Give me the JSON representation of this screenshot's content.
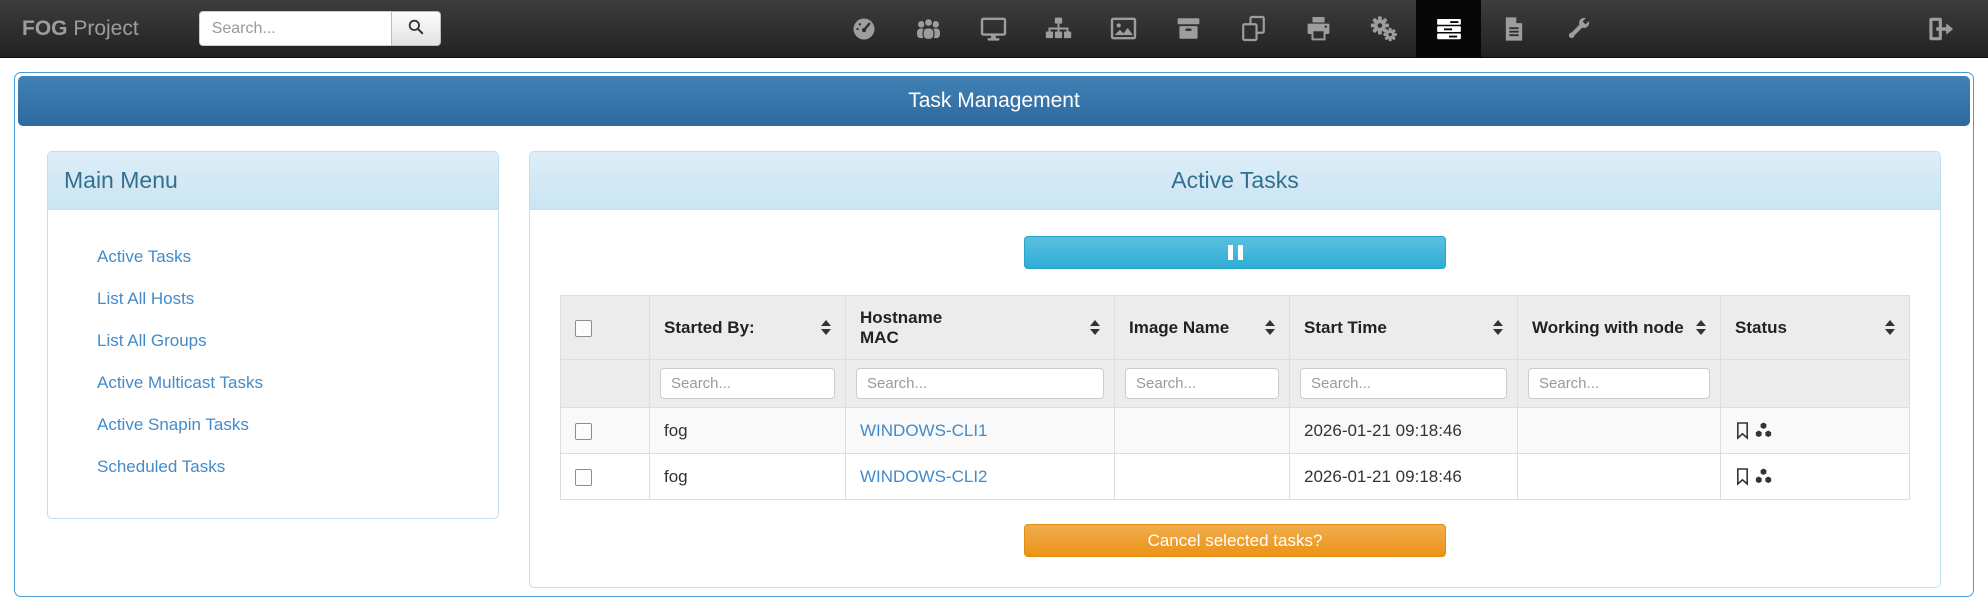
{
  "navbar": {
    "brand_bold": "FOG",
    "brand_rest": " Project",
    "search_placeholder": "Search...",
    "icons": [
      "dashboard",
      "users",
      "host-display",
      "group-sitemap",
      "images",
      "storage-box",
      "snapin-clone",
      "printer",
      "service-gears",
      "tasks",
      "report-file",
      "configuration-wrench"
    ],
    "active_icon": "tasks",
    "signout_icon": "sign-out"
  },
  "page": {
    "title": "Task Management"
  },
  "main_menu": {
    "title": "Main Menu",
    "items": [
      {
        "label": "Active Tasks"
      },
      {
        "label": "List All Hosts"
      },
      {
        "label": "List All Groups"
      },
      {
        "label": "Active Multicast Tasks"
      },
      {
        "label": "Active Snapin Tasks"
      },
      {
        "label": "Scheduled Tasks"
      }
    ]
  },
  "active_tasks": {
    "title": "Active Tasks",
    "pause_button_icon": "pause",
    "cancel_button_label": "Cancel selected tasks?",
    "table": {
      "filter_placeholder": "Search...",
      "columns": [
        {
          "label": "",
          "type": "checkbox"
        },
        {
          "label": "Started By:",
          "sortable": true
        },
        {
          "label": "Hostname",
          "sublabel": "MAC",
          "sortable": true
        },
        {
          "label": "Image Name",
          "sortable": true
        },
        {
          "label": "Start Time",
          "sortable": true
        },
        {
          "label": "Working with node",
          "sortable": true
        },
        {
          "label": "Status",
          "sortable": true
        }
      ],
      "rows": [
        {
          "started_by": "fog",
          "hostname": "WINDOWS-CLI1",
          "image_name": "",
          "start_time": "2026-01-21 09:18:46",
          "working_with_node": "",
          "status_icons": [
            "bookmark",
            "cubes"
          ]
        },
        {
          "started_by": "fog",
          "hostname": "WINDOWS-CLI2",
          "image_name": "",
          "start_time": "2026-01-21 09:18:46",
          "working_with_node": "",
          "status_icons": [
            "bookmark",
            "cubes"
          ]
        }
      ]
    }
  },
  "colors": {
    "navbar_bg": "#222222",
    "navbar_icon": "#9d9d9d",
    "title_bar_blue": "#2c699f",
    "panel_heading_bg": "#d9edf7",
    "panel_heading_text": "#31708f",
    "link_blue": "#428bca",
    "info_button": "#5bc0de",
    "warning_button": "#f0ad4e",
    "outer_border": "#4b9cd6"
  }
}
